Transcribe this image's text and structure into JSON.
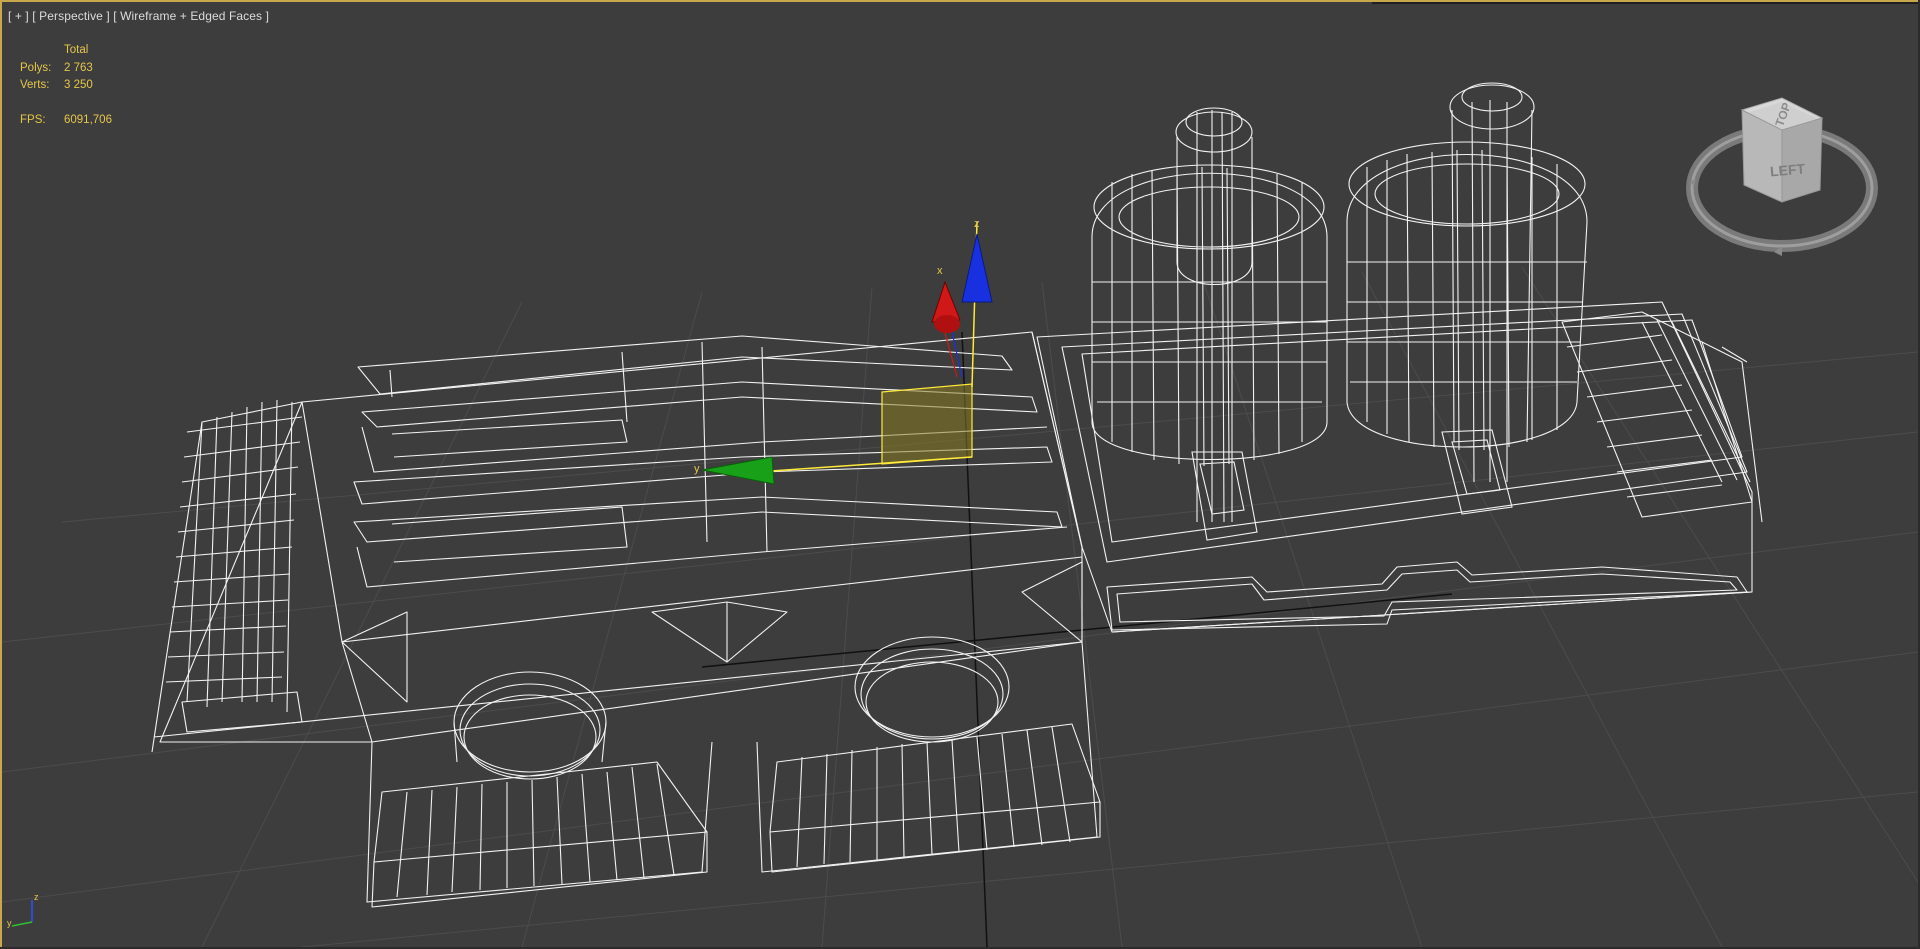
{
  "viewport": {
    "menu_label": "[ + ]",
    "view_label": "[ Perspective ]",
    "shading_label": "[ Wireframe + Edged Faces ]"
  },
  "stats": {
    "header": "Total",
    "polys_label": "Polys:",
    "polys_value": "2 763",
    "verts_label": "Verts:",
    "verts_value": "3 250",
    "fps_label": "FPS:",
    "fps_value": "6091,706"
  },
  "gizmo": {
    "z_label": "z",
    "y_label": "y",
    "x_label": "x"
  },
  "viewcube": {
    "top_label": "TOP",
    "left_label": "LEFT"
  },
  "axis_tripod": {
    "z_label": "z",
    "y_label": "y"
  },
  "colors": {
    "background": "#3d3d3d",
    "wire": "#ffffff",
    "grid": "#4a4a4a",
    "active_border": "#c8a84a",
    "stats_text": "#e6c64a",
    "gizmo_x": "#d01818",
    "gizmo_y": "#18a018",
    "gizmo_z": "#1830e0"
  }
}
